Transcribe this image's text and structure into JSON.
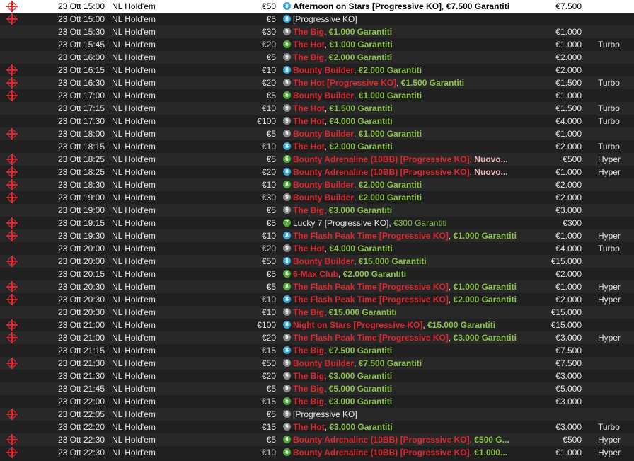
{
  "rows": [
    {
      "icon": true,
      "date": "23 Ott",
      "time": "15:00",
      "game": "NL Hold'em",
      "buyin": "€50",
      "badge": "8",
      "name": "Afternoon on Stars [Progressive KO]",
      "extra": "€7.500 Garantiti",
      "prize": "€7.500",
      "speed": "",
      "style": "dark"
    },
    {
      "icon": true,
      "date": "23 Ott",
      "time": "15:00",
      "game": "NL Hold'em",
      "buyin": "€5",
      "badge": "8",
      "name": "[Progressive KO]",
      "extra": "",
      "prize": "",
      "speed": "",
      "style": "plain"
    },
    {
      "icon": false,
      "date": "23 Ott",
      "time": "15:30",
      "game": "NL Hold'em",
      "buyin": "€30",
      "badge": "9",
      "name": "The Big",
      "extra": "€1.000 Garantiti",
      "prize": "€1.000",
      "speed": "",
      "style": "red"
    },
    {
      "icon": false,
      "date": "23 Ott",
      "time": "15:45",
      "game": "NL Hold'em",
      "buyin": "€20",
      "badge": "6",
      "name": "The Hot",
      "extra": "€1.000 Garantiti",
      "prize": "€1.000",
      "speed": "Turbo",
      "style": "red"
    },
    {
      "icon": false,
      "date": "23 Ott",
      "time": "16:00",
      "game": "NL Hold'em",
      "buyin": "€5",
      "badge": "9",
      "name": "The Big",
      "extra": "€2.000 Garantiti",
      "prize": "€2.000",
      "speed": "",
      "style": "red"
    },
    {
      "icon": true,
      "date": "23 Ott",
      "time": "16:15",
      "game": "NL Hold'em",
      "buyin": "€10",
      "badge": "8",
      "name": "Bounty Builder",
      "extra": "€2.000 Garantiti",
      "prize": "€2.000",
      "speed": "",
      "style": "red"
    },
    {
      "icon": true,
      "date": "23 Ott",
      "time": "16:30",
      "game": "NL Hold'em",
      "buyin": "€20",
      "badge": "9",
      "name": "The Hot [Progressive KO]",
      "extra": "€1.500 Garantiti",
      "prize": "€1.500",
      "speed": "Turbo",
      "style": "red"
    },
    {
      "icon": true,
      "date": "23 Ott",
      "time": "17:00",
      "game": "NL Hold'em",
      "buyin": "€5",
      "badge": "6",
      "name": "Bounty Builder",
      "extra": "€1.000 Garantiti",
      "prize": "€1.000",
      "speed": "",
      "style": "red"
    },
    {
      "icon": false,
      "date": "23 Ott",
      "time": "17:15",
      "game": "NL Hold'em",
      "buyin": "€10",
      "badge": "9",
      "name": "The Hot",
      "extra": "€1.500 Garantiti",
      "prize": "€1.500",
      "speed": "Turbo",
      "style": "red"
    },
    {
      "icon": false,
      "date": "23 Ott",
      "time": "17:30",
      "game": "NL Hold'em",
      "buyin": "€100",
      "badge": "9",
      "name": "The Hot",
      "extra": "€4.000 Garantiti",
      "prize": "€4.000",
      "speed": "Turbo",
      "style": "red"
    },
    {
      "icon": true,
      "date": "23 Ott",
      "time": "18:00",
      "game": "NL Hold'em",
      "buyin": "€5",
      "badge": "9",
      "name": "Bounty Builder",
      "extra": "€1.000 Garantiti",
      "prize": "€1.000",
      "speed": "",
      "style": "red"
    },
    {
      "icon": false,
      "date": "23 Ott",
      "time": "18:15",
      "game": "NL Hold'em",
      "buyin": "€10",
      "badge": "8",
      "name": "The Hot",
      "extra": "€2.000 Garantiti",
      "prize": "€2.000",
      "speed": "Turbo",
      "style": "red"
    },
    {
      "icon": true,
      "date": "23 Ott",
      "time": "18:25",
      "game": "NL Hold'em",
      "buyin": "€5",
      "badge": "6",
      "name": "Bounty Adrenaline (10BB) [Progressive KO]",
      "extra": "Nuovo...",
      "prize": "€500",
      "speed": "Hyper",
      "style": "red",
      "extraStyle": "nuovo"
    },
    {
      "icon": true,
      "date": "23 Ott",
      "time": "18:25",
      "game": "NL Hold'em",
      "buyin": "€20",
      "badge": "8",
      "name": "Bounty Adrenaline (10BB) [Progressive KO]",
      "extra": "Nuovo...",
      "prize": "€1.000",
      "speed": "Hyper",
      "style": "red",
      "extraStyle": "nuovo"
    },
    {
      "icon": true,
      "date": "23 Ott",
      "time": "18:30",
      "game": "NL Hold'em",
      "buyin": "€10",
      "badge": "6",
      "name": "Bounty Builder",
      "extra": "€2.000 Garantiti",
      "prize": "€2.000",
      "speed": "",
      "style": "red"
    },
    {
      "icon": true,
      "date": "23 Ott",
      "time": "19:00",
      "game": "NL Hold'em",
      "buyin": "€30",
      "badge": "9",
      "name": "Bounty Builder",
      "extra": "€2.000 Garantiti",
      "prize": "€2.000",
      "speed": "",
      "style": "red"
    },
    {
      "icon": false,
      "date": "23 Ott",
      "time": "19:00",
      "game": "NL Hold'em",
      "buyin": "€5",
      "badge": "9",
      "name": "The Big",
      "extra": "€3.000 Garantiti",
      "prize": "€3.000",
      "speed": "",
      "style": "red"
    },
    {
      "icon": true,
      "date": "23 Ott",
      "time": "19:15",
      "game": "NL Hold'em",
      "buyin": "€5",
      "badge": "7",
      "name": "Lucky 7 [Progressive KO]",
      "extra": "€300 Garantiti",
      "prize": "€300",
      "speed": "",
      "style": "plain",
      "extraStyle": "normal"
    },
    {
      "icon": true,
      "date": "23 Ott",
      "time": "19:30",
      "game": "NL Hold'em",
      "buyin": "€10",
      "badge": "8",
      "name": "The Flash Peak Time [Progressive KO]",
      "extra": "€1.000 Garantiti",
      "prize": "€1.000",
      "speed": "Hyper",
      "style": "red"
    },
    {
      "icon": false,
      "date": "23 Ott",
      "time": "20:00",
      "game": "NL Hold'em",
      "buyin": "€20",
      "badge": "9",
      "name": "The Hot",
      "extra": "€4.000 Garantiti",
      "prize": "€4.000",
      "speed": "Turbo",
      "style": "red"
    },
    {
      "icon": true,
      "date": "23 Ott",
      "time": "20:00",
      "game": "NL Hold'em",
      "buyin": "€50",
      "badge": "8",
      "name": "Bounty Builder",
      "extra": "€15.000 Garantiti",
      "prize": "€15.000",
      "speed": "",
      "style": "red"
    },
    {
      "icon": false,
      "date": "23 Ott",
      "time": "20:15",
      "game": "NL Hold'em",
      "buyin": "€5",
      "badge": "6",
      "name": "6-Max Club",
      "extra": "€2.000 Garantiti",
      "prize": "€2.000",
      "speed": "",
      "style": "red"
    },
    {
      "icon": true,
      "date": "23 Ott",
      "time": "20:30",
      "game": "NL Hold'em",
      "buyin": "€5",
      "badge": "6",
      "name": "The Flash Peak Time [Progressive KO]",
      "extra": "€1.000 Garantiti",
      "prize": "€1.000",
      "speed": "Hyper",
      "style": "red"
    },
    {
      "icon": true,
      "date": "23 Ott",
      "time": "20:30",
      "game": "NL Hold'em",
      "buyin": "€10",
      "badge": "8",
      "name": "The Flash Peak Time [Progressive KO]",
      "extra": "€2.000 Garantiti",
      "prize": "€2.000",
      "speed": "Hyper",
      "style": "red"
    },
    {
      "icon": false,
      "date": "23 Ott",
      "time": "20:30",
      "game": "NL Hold'em",
      "buyin": "€10",
      "badge": "9",
      "name": "The Big",
      "extra": "€15.000 Garantiti",
      "prize": "€15.000",
      "speed": "",
      "style": "red"
    },
    {
      "icon": true,
      "date": "23 Ott",
      "time": "21:00",
      "game": "NL Hold'em",
      "buyin": "€100",
      "badge": "8",
      "name": "Night on Stars [Progressive KO]",
      "extra": "€15.000 Garantiti",
      "prize": "€15.000",
      "speed": "",
      "style": "red"
    },
    {
      "icon": true,
      "date": "23 Ott",
      "time": "21:00",
      "game": "NL Hold'em",
      "buyin": "€20",
      "badge": "9",
      "name": "The Flash Peak Time [Progressive KO]",
      "extra": "€3.000 Garantiti",
      "prize": "€3.000",
      "speed": "Hyper",
      "style": "red"
    },
    {
      "icon": false,
      "date": "23 Ott",
      "time": "21:15",
      "game": "NL Hold'em",
      "buyin": "€15",
      "badge": "8",
      "name": "The Big",
      "extra": "€7.500 Garantiti",
      "prize": "€7.500",
      "speed": "",
      "style": "red"
    },
    {
      "icon": true,
      "date": "23 Ott",
      "time": "21:30",
      "game": "NL Hold'em",
      "buyin": "€50",
      "badge": "9",
      "name": "Bounty Builder",
      "extra": "€7.500 Garantiti",
      "prize": "€7.500",
      "speed": "",
      "style": "red"
    },
    {
      "icon": false,
      "date": "23 Ott",
      "time": "21:30",
      "game": "NL Hold'em",
      "buyin": "€20",
      "badge": "9",
      "name": "The Big",
      "extra": "€3.000 Garantiti",
      "prize": "€3.000",
      "speed": "",
      "style": "red"
    },
    {
      "icon": false,
      "date": "23 Ott",
      "time": "21:45",
      "game": "NL Hold'em",
      "buyin": "€5",
      "badge": "9",
      "name": "The Big",
      "extra": "€5.000 Garantiti",
      "prize": "€5.000",
      "speed": "",
      "style": "red"
    },
    {
      "icon": false,
      "date": "23 Ott",
      "time": "22:00",
      "game": "NL Hold'em",
      "buyin": "€15",
      "badge": "6",
      "name": "The Big",
      "extra": "€3.000 Garantiti",
      "prize": "€3.000",
      "speed": "",
      "style": "red"
    },
    {
      "icon": true,
      "date": "23 Ott",
      "time": "22:05",
      "game": "NL Hold'em",
      "buyin": "€5",
      "badge": "9",
      "name": "[Progressive KO]",
      "extra": "",
      "prize": "",
      "speed": "",
      "style": "plain"
    },
    {
      "icon": false,
      "date": "23 Ott",
      "time": "22:20",
      "game": "NL Hold'em",
      "buyin": "€15",
      "badge": "9",
      "name": "The Hot",
      "extra": "€3.000 Garantiti",
      "prize": "€3.000",
      "speed": "Turbo",
      "style": "red"
    },
    {
      "icon": true,
      "date": "23 Ott",
      "time": "22:30",
      "game": "NL Hold'em",
      "buyin": "€5",
      "badge": "6",
      "name": "Bounty Adrenaline (10BB) [Progressive KO]",
      "extra": "€500 G...",
      "prize": "€500",
      "speed": "Hyper",
      "style": "red"
    },
    {
      "icon": true,
      "date": "23 Ott",
      "time": "22:30",
      "game": "NL Hold'em",
      "buyin": "€10",
      "badge": "6",
      "name": "Bounty Adrenaline (10BB) [Progressive KO]",
      "extra": "€1.000...",
      "prize": "€1.000",
      "speed": "Hyper",
      "style": "red"
    }
  ],
  "colors": {
    "red": "#e0262e",
    "green": "#8bc34a",
    "badge8": "#3aa6d8",
    "badge9": "#8a8a8a",
    "badge6": "#4fa83a",
    "selected_bg": "#ffffff",
    "row_bg": "#282828",
    "row_bg_alt": "#202020"
  },
  "icons": {
    "target": "target-icon",
    "badge": "table-size-badge"
  }
}
